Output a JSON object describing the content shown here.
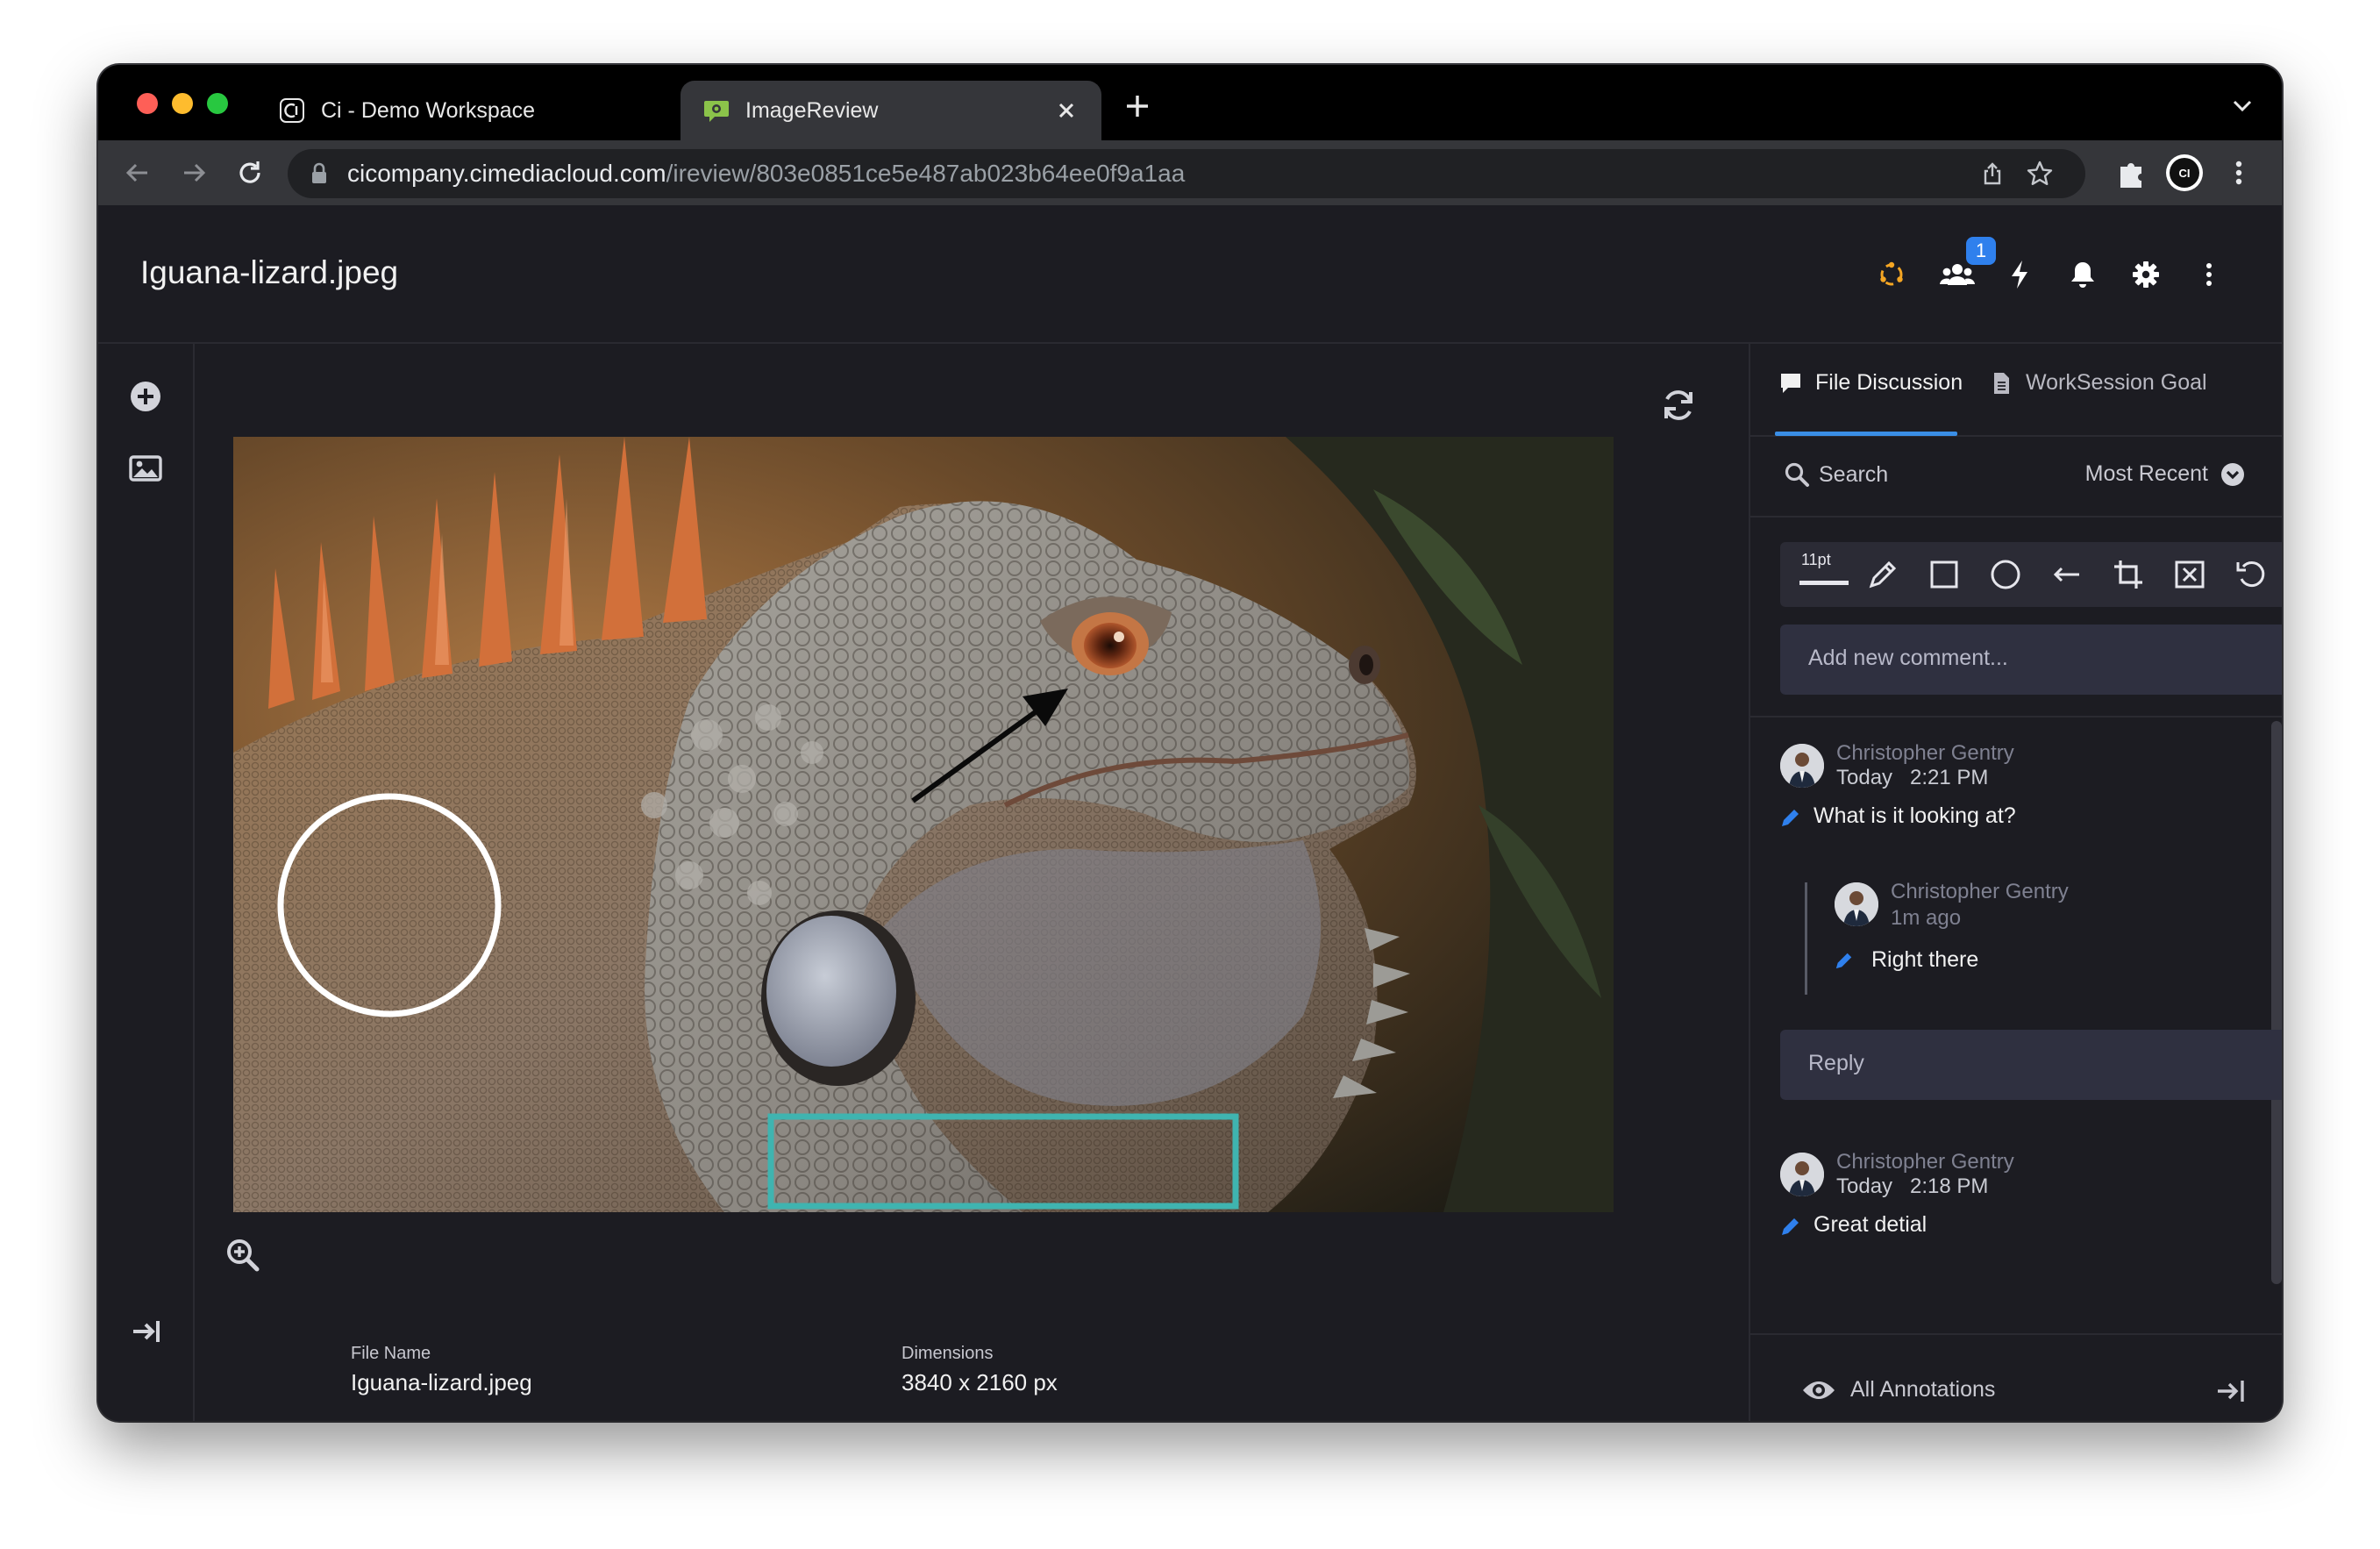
{
  "browser": {
    "tabs": [
      {
        "title": "Ci - Demo Workspace",
        "favicon": "ci-logo-icon"
      },
      {
        "title": "ImageReview",
        "favicon": "image-review-icon",
        "active": true
      }
    ],
    "url_host": "cicompany.cimediacloud.com",
    "url_path": "/ireview/803e0851ce5e487ab023b64ee0f9a1aa",
    "profile_label": "CI"
  },
  "header": {
    "title": "Iguana-lizard.jpeg",
    "users_badge": "1",
    "icons": [
      "share-orbit-icon",
      "users-icon",
      "bolt-icon",
      "bell-icon",
      "gear-icon",
      "more-vertical-icon"
    ]
  },
  "viewer": {
    "file_name_label": "File Name",
    "file_name": "Iguana-lizard.jpeg",
    "dimensions_label": "Dimensions",
    "dimensions": "3840 x 2160 px"
  },
  "panel": {
    "tab_discussion": "File Discussion",
    "tab_goal": "WorkSession Goal",
    "search": "Search",
    "sort": "Most Recent",
    "stroke_size": "11pt",
    "add_comment_placeholder": "Add new comment...",
    "reply_placeholder": "Reply",
    "all_annotations": "All Annotations",
    "comments": [
      {
        "author": "Christopher Gentry",
        "day": "Today",
        "time": "2:21 PM",
        "text": "What is it looking at?"
      },
      {
        "author": "Christopher Gentry",
        "time": "1m ago",
        "text": "Right there"
      },
      {
        "author": "Christopher Gentry",
        "day": "Today",
        "time": "2:18 PM",
        "text": "Great detial"
      }
    ]
  },
  "colors": {
    "accent": "#3a8ee6",
    "annotation_rect": "#3fb4b0",
    "annotation_circle": "#ffffff",
    "orbit": "#f5a623"
  }
}
